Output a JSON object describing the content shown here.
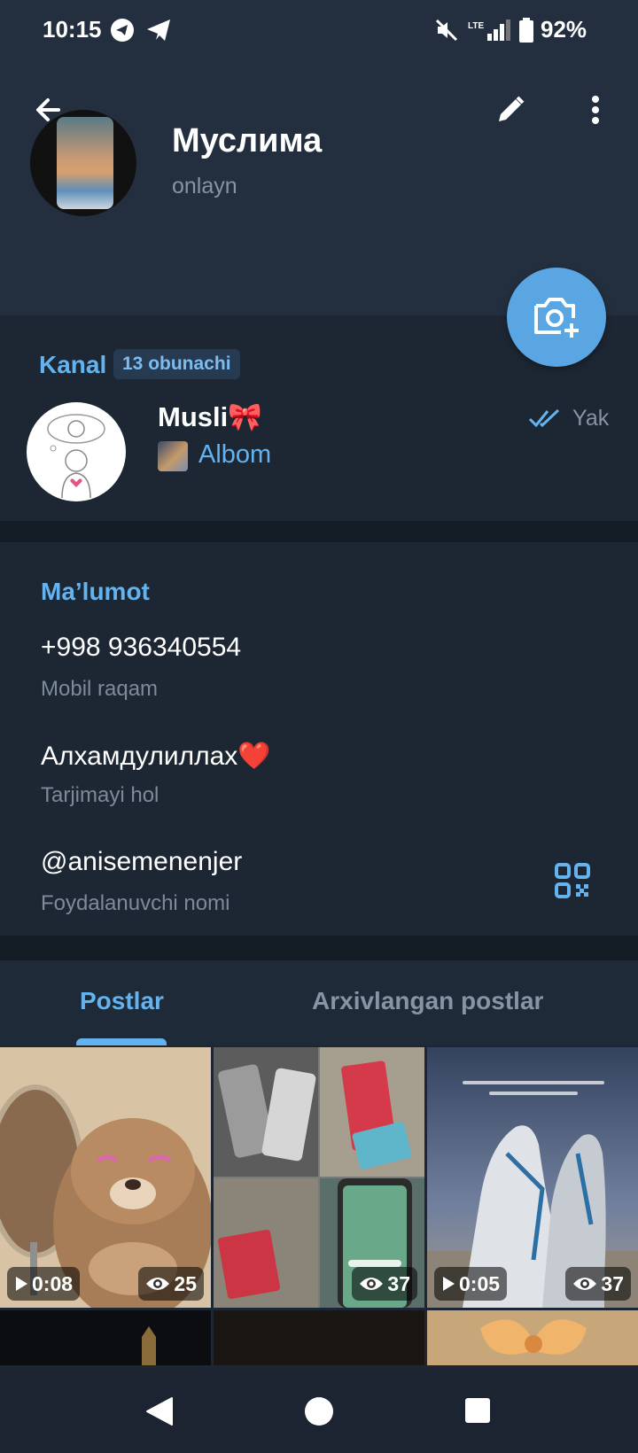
{
  "status_bar": {
    "time": "10:15",
    "battery": "92%"
  },
  "profile": {
    "name": "Муслима",
    "status": "onlayn"
  },
  "channel": {
    "label": "Kanal",
    "subscribers": "13 obunachi",
    "name": "Musli🎀",
    "last_post": "Albom",
    "time": "Yak"
  },
  "info": {
    "title": "Ma’lumot",
    "phone": "+998 936340554",
    "phone_label": "Mobil raqam",
    "bio": "Алхамдулиллах❤️",
    "bio_label": "Tarjimayi hol",
    "username": "@anisemenenjer",
    "username_label": "Foydalanuvchi nomi"
  },
  "tabs": [
    {
      "label": "Postlar",
      "active": true
    },
    {
      "label": "Arxivlangan postlar",
      "active": false
    }
  ],
  "posts": [
    {
      "duration": "0:08",
      "views": "25",
      "type": "video"
    },
    {
      "duration": "",
      "views": "37",
      "type": "album"
    },
    {
      "duration": "0:05",
      "views": "37",
      "type": "video"
    }
  ],
  "colors": {
    "accent": "#64b3ee",
    "fab": "#5aa6e3",
    "background": "#1d2733",
    "header": "#232f3e"
  }
}
